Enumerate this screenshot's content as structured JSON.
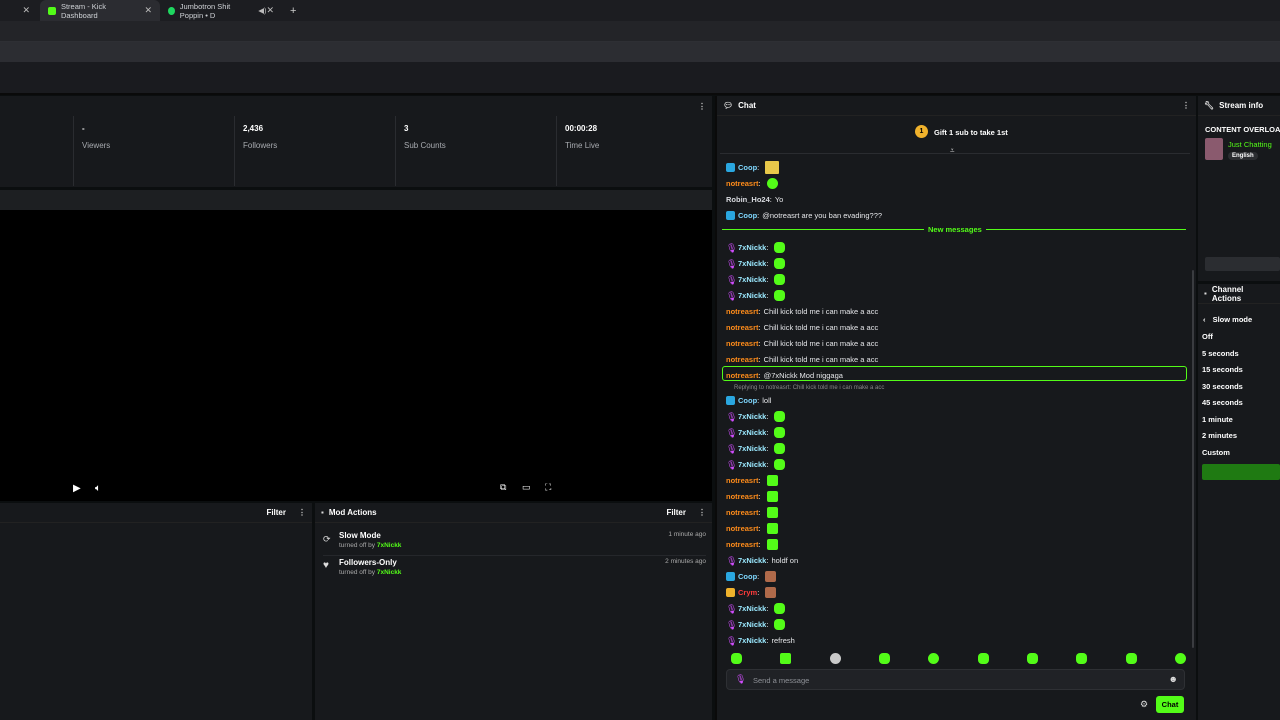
{
  "browser": {
    "tabs": [
      {
        "title": "Stream - Kick Dashboard",
        "active": true
      },
      {
        "title": "Jumbotron Shit Poppin • D",
        "active": false
      }
    ],
    "new_tab": "+"
  },
  "stats": [
    {
      "value": "-",
      "label": "Viewers"
    },
    {
      "value": "2,436",
      "label": "Followers"
    },
    {
      "value": "3",
      "label": "Sub Counts"
    },
    {
      "value": "00:00:28",
      "label": "Time Live"
    }
  ],
  "left_bottom": {
    "filter_label": "Filter"
  },
  "mod_actions": {
    "title": "Mod Actions",
    "filter_label": "Filter",
    "items": [
      {
        "title": "Slow Mode",
        "by_prefix": "turned off by",
        "by_user": "7xNickk",
        "time": "1 minute ago"
      },
      {
        "title": "Followers-Only",
        "by_prefix": "turned off by",
        "by_user": "7xNickk",
        "time": "2 minutes ago"
      }
    ]
  },
  "chat": {
    "title": "Chat",
    "gift_banner": "Gift 1 sub to take 1st",
    "gift_rank": "1",
    "new_messages": "New messages",
    "reply_note": "Replying to notreasrt: Chill kick told me i can make a acc",
    "input_placeholder": "Send a message",
    "send_label": "Chat",
    "messages": [
      {
        "user": "Coop",
        "kind": "coop",
        "text": "",
        "emote": "bang"
      },
      {
        "user": "notreasrt",
        "kind": "not",
        "text": "",
        "emote": "round"
      },
      {
        "user": "Robin_Ho24",
        "kind": "rob",
        "text": "Yo",
        "emote": ""
      },
      {
        "user": "Coop",
        "kind": "coop",
        "text": "@notreasrt are you ban evading???",
        "emote": ""
      },
      {
        "user": "7xNickk",
        "kind": "7x",
        "text": "",
        "emote": "green"
      },
      {
        "user": "7xNickk",
        "kind": "7x",
        "text": "",
        "emote": "green"
      },
      {
        "user": "7xNickk",
        "kind": "7x",
        "text": "",
        "emote": "green"
      },
      {
        "user": "7xNickk",
        "kind": "7x",
        "text": "",
        "emote": "green"
      },
      {
        "user": "notreasrt",
        "kind": "not",
        "text": "Chill kick told me i can make a acc",
        "emote": ""
      },
      {
        "user": "notreasrt",
        "kind": "not",
        "text": "Chill kick told me i can make a acc",
        "emote": ""
      },
      {
        "user": "notreasrt",
        "kind": "not",
        "text": "Chill kick told me i can make a acc",
        "emote": ""
      },
      {
        "user": "notreasrt",
        "kind": "not",
        "text": "Chill kick told me i can make a acc",
        "emote": ""
      },
      {
        "user": "notreasrt",
        "kind": "not",
        "text": "@7xNickk Mod niggaga",
        "emote": ""
      },
      {
        "user": "Coop",
        "kind": "coop",
        "text": "loll",
        "emote": ""
      },
      {
        "user": "7xNickk",
        "kind": "7x",
        "text": "",
        "emote": "green"
      },
      {
        "user": "7xNickk",
        "kind": "7x",
        "text": "",
        "emote": "green"
      },
      {
        "user": "7xNickk",
        "kind": "7x",
        "text": "",
        "emote": "green"
      },
      {
        "user": "7xNickk",
        "kind": "7x",
        "text": "",
        "emote": "green"
      },
      {
        "user": "notreasrt",
        "kind": "not",
        "text": "",
        "emote": "sq"
      },
      {
        "user": "notreasrt",
        "kind": "not",
        "text": "",
        "emote": "sq"
      },
      {
        "user": "notreasrt",
        "kind": "not",
        "text": "",
        "emote": "sq"
      },
      {
        "user": "notreasrt",
        "kind": "not",
        "text": "",
        "emote": "sq"
      },
      {
        "user": "notreasrt",
        "kind": "not",
        "text": "",
        "emote": "sq"
      },
      {
        "user": "7xNickk",
        "kind": "7x",
        "text": "holdf on",
        "emote": ""
      },
      {
        "user": "Coop",
        "kind": "coop",
        "text": "",
        "emote": "img"
      },
      {
        "user": "Crym",
        "kind": "cry",
        "text": "",
        "emote": "img"
      },
      {
        "user": "7xNickk",
        "kind": "7x",
        "text": "",
        "emote": "green"
      },
      {
        "user": "7xNickk",
        "kind": "7x",
        "text": "",
        "emote": "green"
      },
      {
        "user": "7xNickk",
        "kind": "7x",
        "text": "refresh",
        "emote": ""
      }
    ]
  },
  "stream_info": {
    "title": "Stream info",
    "stream_title": "CONTENT OVERLOAD",
    "category": "Just Chatting",
    "language": "English"
  },
  "channel_actions": {
    "title": "Channel Actions",
    "slow_mode_label": "Slow mode",
    "options": [
      "Off",
      "5 seconds",
      "15 seconds",
      "30 seconds",
      "45 seconds",
      "1 minute",
      "2 minutes",
      "Custom"
    ]
  },
  "colors": {
    "accent": "#53fc18",
    "panel": "#17191c",
    "bg": "#0b0e0f"
  }
}
